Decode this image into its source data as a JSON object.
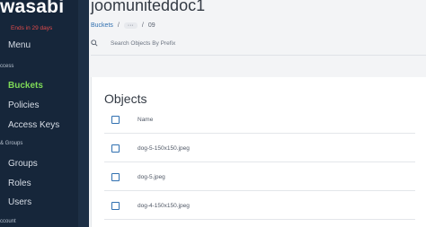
{
  "sidebar": {
    "logo": "wasabi",
    "trial": "Ends in 29 days",
    "menu": "Menu",
    "sections": {
      "access": "ccess",
      "groups": "& Groups",
      "account": "ccount"
    },
    "items": [
      {
        "label": "Buckets",
        "active": true
      },
      {
        "label": "Policies",
        "active": false
      },
      {
        "label": "Access Keys",
        "active": false
      },
      {
        "label": "Groups",
        "active": false
      },
      {
        "label": "Roles",
        "active": false
      },
      {
        "label": "Users",
        "active": false
      }
    ]
  },
  "header": {
    "title": "joomuniteddoc1",
    "breadcrumb": {
      "root": "Buckets",
      "sep1": "/",
      "ellipsis": "···",
      "sep2": "/",
      "current": "09"
    }
  },
  "search": {
    "placeholder": "Search Objects By Prefix"
  },
  "objects": {
    "title": "Objects",
    "column_name": "Name",
    "rows": [
      {
        "name": "dog-5-150x150.jpeg"
      },
      {
        "name": "dog-5.jpeg"
      },
      {
        "name": "dog-4-150x150.jpeg"
      }
    ]
  },
  "colors": {
    "sidebar_bg": "#16263a",
    "active_green": "#7ed957",
    "trial_red": "#e24b4b",
    "link_blue": "#2f6fb0"
  }
}
